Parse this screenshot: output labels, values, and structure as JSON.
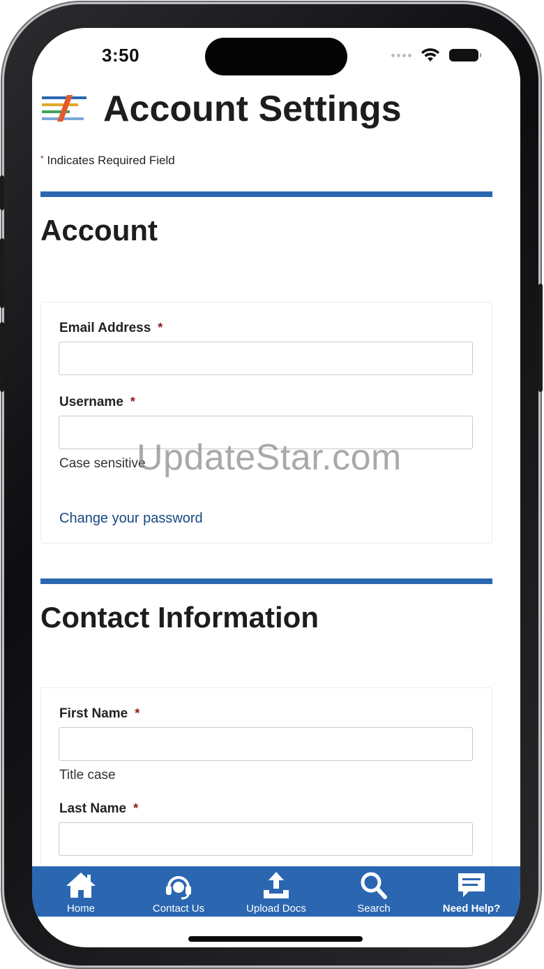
{
  "status_bar": {
    "time": "3:50"
  },
  "header": {
    "title": "Account Settings",
    "logo_icon": "striped-flag-logo"
  },
  "required_note": {
    "star": "*",
    "text": "Indicates Required Field"
  },
  "account_section": {
    "heading": "Account",
    "email_label": "Email Address",
    "username_label": "Username",
    "username_hint": "Case sensitive",
    "change_password_link": "Change your password"
  },
  "contact_section": {
    "heading": "Contact Information",
    "first_name_label": "First Name",
    "first_name_hint": "Title case",
    "last_name_label": "Last Name"
  },
  "required_marker": "*",
  "watermark": "UpdateStar.com",
  "tab_bar": {
    "items": [
      {
        "label": "Home",
        "icon": "home-icon"
      },
      {
        "label": "Contact Us",
        "icon": "headset-icon"
      },
      {
        "label": "Upload Docs",
        "icon": "upload-icon"
      },
      {
        "label": "Search",
        "icon": "search-icon"
      },
      {
        "label": "Need Help?",
        "icon": "chat-bubble-icon"
      }
    ]
  },
  "colors": {
    "accent_blue": "#2b67b0",
    "link_blue": "#17487f",
    "required_red": "#8b1c1c"
  }
}
